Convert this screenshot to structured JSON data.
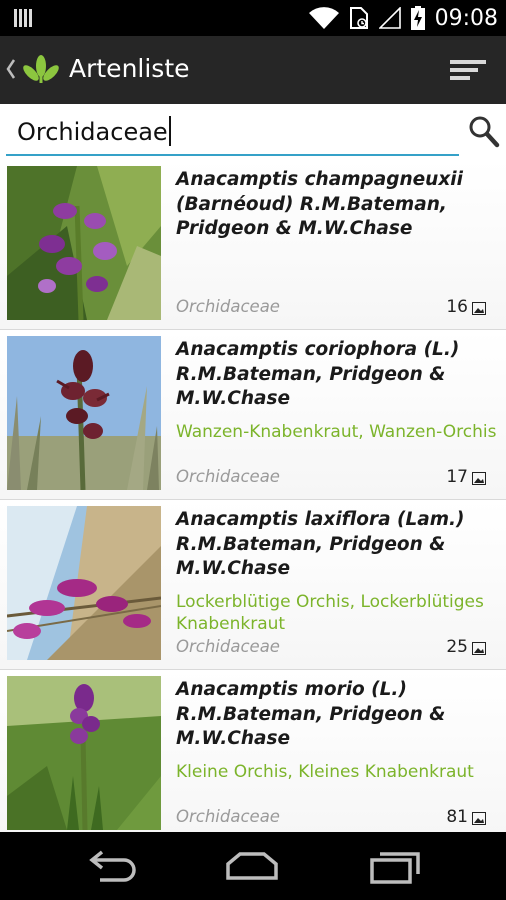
{
  "status_bar": {
    "time": "09:08",
    "icons": [
      "notification-bars-icon",
      "wifi-icon",
      "sd-card-icon",
      "signal-icon",
      "battery-charging-icon"
    ]
  },
  "action_bar": {
    "back_icon": "chevron-left-icon",
    "logo_icon": "leaf-logo-icon",
    "title": "Artenliste",
    "menu_icon": "sort-menu-icon"
  },
  "search": {
    "value": "Orchidaceae",
    "icon": "search-icon"
  },
  "species": [
    {
      "name": "Anacamptis champagneuxii (Barnéoud) R.M.Bateman, Pridgeon & M.W.Chase",
      "common_name": "",
      "family": "Orchidaceae",
      "image_count": "16"
    },
    {
      "name": "Anacamptis coriophora (L.) R.M.Bateman, Pridgeon & M.W.Chase",
      "common_name": "Wanzen-Knabenkraut, Wanzen-Orchis",
      "family": "Orchidaceae",
      "image_count": "17"
    },
    {
      "name": "Anacamptis laxiflora (Lam.) R.M.Bateman, Pridgeon & M.W.Chase",
      "common_name": "Lockerblütige Orchis, Lockerblütiges Knabenkraut",
      "family": "Orchidaceae",
      "image_count": "25"
    },
    {
      "name": "Anacamptis morio (L.) R.M.Bateman, Pridgeon & M.W.Chase",
      "common_name": "Kleine Orchis, Kleines Knabenkraut",
      "family": "Orchidaceae",
      "image_count": "81"
    }
  ],
  "nav_bar": {
    "icons": [
      "back-icon",
      "home-icon",
      "recent-apps-icon"
    ]
  },
  "colors": {
    "accent": "#35a1c8",
    "common_name": "#7cb42b",
    "action_bar": "#262626"
  }
}
